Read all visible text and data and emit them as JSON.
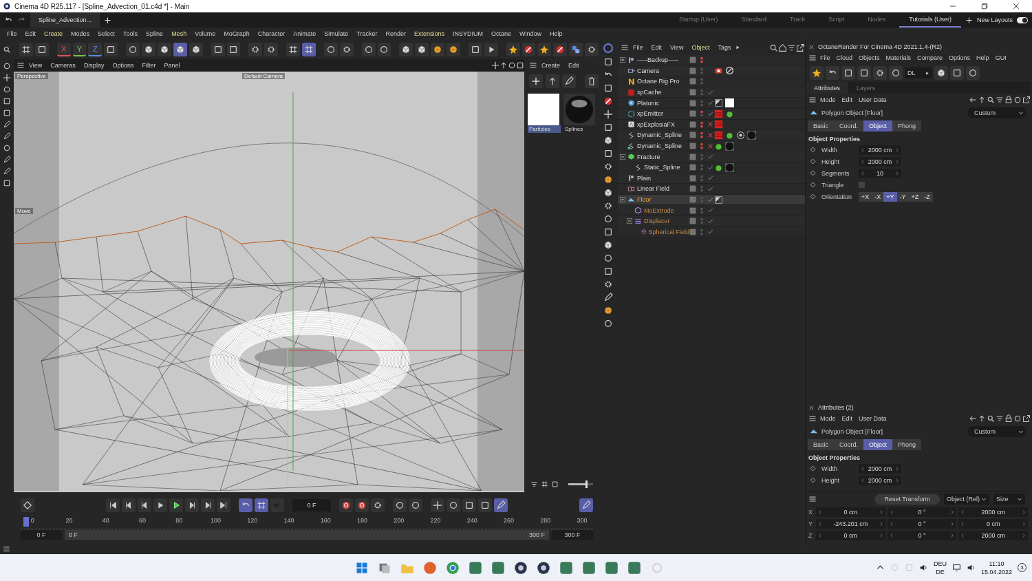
{
  "window": {
    "title": "Cinema 4D R25.117 - [Spline_Advection_01.c4d *] - Main"
  },
  "document_tab": {
    "label": "Spline_Advection..."
  },
  "layouts": [
    {
      "label": "Startup (User)",
      "selected": false
    },
    {
      "label": "Standard",
      "selected": false
    },
    {
      "label": "Track",
      "selected": false
    },
    {
      "label": "Script",
      "selected": false
    },
    {
      "label": "Nodes",
      "selected": false
    },
    {
      "label": "Tutorials (User)",
      "selected": true
    }
  ],
  "new_layouts": {
    "label": "New Layouts",
    "on": true
  },
  "menu": [
    {
      "label": "File",
      "highlight": false
    },
    {
      "label": "Edit",
      "highlight": false
    },
    {
      "label": "Create",
      "highlight": true
    },
    {
      "label": "Modes",
      "highlight": false
    },
    {
      "label": "Select",
      "highlight": false
    },
    {
      "label": "Tools",
      "highlight": false
    },
    {
      "label": "Spline",
      "highlight": false
    },
    {
      "label": "Mesh",
      "highlight": true
    },
    {
      "label": "Volume",
      "highlight": false
    },
    {
      "label": "MoGraph",
      "highlight": false
    },
    {
      "label": "Character",
      "highlight": false
    },
    {
      "label": "Animate",
      "highlight": false
    },
    {
      "label": "Simulate",
      "highlight": false
    },
    {
      "label": "Tracker",
      "highlight": false
    },
    {
      "label": "Render",
      "highlight": false
    },
    {
      "label": "Extensions",
      "highlight": true
    },
    {
      "label": "INSYDIUM",
      "highlight": false
    },
    {
      "label": "Octane",
      "highlight": false
    },
    {
      "label": "Window",
      "highlight": false
    },
    {
      "label": "Help",
      "highlight": false
    }
  ],
  "axis_locks": [
    {
      "label": "X",
      "color": "#e05555"
    },
    {
      "label": "Y",
      "color": "#7fbf4a"
    },
    {
      "label": "Z",
      "color": "#5a8ee0"
    }
  ],
  "viewport": {
    "menu": [
      "View",
      "Cameras",
      "Display",
      "Options",
      "Filter",
      "Panel"
    ],
    "camera_label": "Perspective",
    "camera_name": "Default Camera",
    "tool_label": "Move"
  },
  "content_browser": {
    "menu": [
      "Create",
      "Edit"
    ],
    "materials": [
      {
        "name": "Particles",
        "kind": "white",
        "selected": true
      },
      {
        "name": "Splines",
        "kind": "black",
        "selected": false
      }
    ],
    "zoom": {
      "level": 0.7
    }
  },
  "object_manager": {
    "menu": [
      {
        "label": "File",
        "highlight": false
      },
      {
        "label": "Edit",
        "highlight": false
      },
      {
        "label": "View",
        "highlight": false
      },
      {
        "label": "Object",
        "highlight": true
      },
      {
        "label": "Tags",
        "highlight": false
      }
    ],
    "objects": [
      {
        "name": "-----Backup-----",
        "kind": "null",
        "selected": false,
        "expanded": false,
        "editor_visible": false,
        "render_visible": false
      },
      {
        "name": "Camera",
        "kind": "camera",
        "selected": false,
        "editor_visible": true,
        "render_visible": true,
        "tags": [
          {
            "kind": "camera"
          },
          {
            "kind": "forbid"
          }
        ]
      },
      {
        "name": "Octane Rig Pro",
        "kind": "octane",
        "selected": false,
        "editor_visible": true,
        "render_visible": true
      },
      {
        "name": "xpCache",
        "kind": "xp",
        "selected": false,
        "editor_visible": true,
        "render_visible": true,
        "enabled": true
      },
      {
        "name": "Platonic",
        "kind": "platonic",
        "selected": false,
        "editor_visible": true,
        "render_visible": true,
        "enabled": true,
        "tags": [
          {
            "kind": "display"
          },
          {
            "kind": "white-material"
          }
        ]
      },
      {
        "name": "xpEmitter",
        "kind": "emitter",
        "selected": false,
        "editor_visible": false,
        "render_visible": true,
        "enabled": true,
        "tags": [
          {
            "kind": "xp"
          },
          {
            "kind": "green-dot"
          }
        ]
      },
      {
        "name": "xpExplosiaFX",
        "kind": "explosia",
        "selected": false,
        "editor_visible": false,
        "render_visible": false,
        "enabled": false,
        "tags": [
          {
            "kind": "xp"
          }
        ]
      },
      {
        "name": "Dynamic_Spline",
        "kind": "spline",
        "selected": false,
        "editor_visible": false,
        "render_visible": false,
        "enabled": false,
        "tags": [
          {
            "kind": "xp"
          },
          {
            "kind": "green-dot"
          },
          {
            "kind": "target"
          },
          {
            "kind": "black-material"
          }
        ]
      },
      {
        "name": "Dynamic_Spline",
        "kind": "spline-gen",
        "selected": false,
        "editor_visible": false,
        "render_visible": false,
        "enabled": false,
        "tags": [
          {
            "kind": "green-dot"
          },
          {
            "kind": "black-material"
          }
        ]
      },
      {
        "name": "Fracture",
        "kind": "fracture",
        "selected": false,
        "expanded": true,
        "editor_visible": true,
        "render_visible": true,
        "enabled": true,
        "children": [
          {
            "name": "Static_Spline",
            "kind": "spline",
            "selected": false,
            "editor_visible": true,
            "render_visible": true,
            "enabled": true,
            "tags": [
              {
                "kind": "green-dot"
              },
              {
                "kind": "black-material"
              }
            ]
          }
        ]
      },
      {
        "name": "Plain",
        "kind": "null",
        "selected": false,
        "editor_visible": true,
        "render_visible": true,
        "enabled": true
      },
      {
        "name": "Linear Field",
        "kind": "field",
        "selected": false,
        "editor_visible": true,
        "render_visible": true,
        "enabled": true
      },
      {
        "name": "Floor",
        "kind": "plane",
        "selected": true,
        "expanded": true,
        "editor_visible": true,
        "render_visible": true,
        "enabled": true,
        "tags": [
          {
            "kind": "display"
          }
        ],
        "children": [
          {
            "name": "MoExtrude",
            "kind": "moextrude",
            "selected": false,
            "editor_visible": true,
            "render_visible": true,
            "enabled": true
          },
          {
            "name": "Displacer",
            "kind": "displacer",
            "selected": false,
            "expanded": true,
            "editor_visible": true,
            "render_visible": true,
            "enabled": true,
            "children": [
              {
                "name": "Spherical Field",
                "kind": "sphere-field",
                "selected": false,
                "editor_visible": true,
                "render_visible": true,
                "enabled": true
              }
            ]
          }
        ]
      }
    ]
  },
  "octane": {
    "title": "OctaneRender For Cinema 4D 2021.1.4-(R2)",
    "menu": [
      "File",
      "Cloud",
      "Objects",
      "Materials",
      "Compare",
      "Options",
      "Help",
      "GUI"
    ],
    "dropdown": "DL"
  },
  "attributes": {
    "tabs": [
      {
        "label": "Attributes",
        "selected": true
      },
      {
        "label": "Layers",
        "selected": false
      }
    ],
    "menu": [
      "Mode",
      "Edit",
      "User Data"
    ],
    "object": "Polygon Object [Floor]",
    "preset": "Custom",
    "sections": [
      {
        "label": "Basic",
        "selected": false
      },
      {
        "label": "Coord.",
        "selected": false
      },
      {
        "label": "Object",
        "selected": true
      },
      {
        "label": "Phong",
        "selected": false
      }
    ],
    "heading": "Object Properties",
    "fields": [
      {
        "kind": "number",
        "label": "Width",
        "value": "2000 cm"
      },
      {
        "kind": "number",
        "label": "Height",
        "value": "2000 cm"
      },
      {
        "kind": "number",
        "label": "Segments",
        "value": "10"
      },
      {
        "kind": "checkbox",
        "label": "Triangle",
        "checked": false
      },
      {
        "kind": "buttons",
        "label": "Orientation",
        "options": [
          {
            "label": "+X",
            "selected": false
          },
          {
            "label": "-X",
            "selected": false
          },
          {
            "label": "+Y",
            "selected": true
          },
          {
            "label": "-Y",
            "selected": false
          },
          {
            "label": "+Z",
            "selected": false
          },
          {
            "label": "-Z",
            "selected": false
          }
        ]
      }
    ]
  },
  "attributes_2": {
    "title": "Attributes (2)",
    "menu": [
      "Mode",
      "Edit",
      "User Data"
    ],
    "object": "Polygon Object [Floor]",
    "preset": "Custom",
    "sections": [
      {
        "label": "Basic",
        "selected": false
      },
      {
        "label": "Coord.",
        "selected": false
      },
      {
        "label": "Object",
        "selected": true
      },
      {
        "label": "Phong",
        "selected": false
      }
    ],
    "heading": "Object Properties",
    "fields": [
      {
        "kind": "number",
        "label": "Width",
        "value": "2000 cm"
      },
      {
        "kind": "number",
        "label": "Height",
        "value": "2000 cm"
      }
    ]
  },
  "coordinates": {
    "reset": "Reset Transform",
    "mode": "Object (Rel)",
    "size_mode": "Size",
    "rows": [
      {
        "axis": "X",
        "values": [
          "0 cm",
          "0 °",
          "2000 cm"
        ]
      },
      {
        "axis": "Y",
        "values": [
          "-243.201 cm",
          "0 °",
          "0 cm"
        ]
      },
      {
        "axis": "Z",
        "values": [
          "0 cm",
          "0 °",
          "2000 cm"
        ]
      }
    ]
  },
  "timeline": {
    "frame": "0 F",
    "ruler_labels": [
      "0",
      "20",
      "40",
      "60",
      "80",
      "100",
      "120",
      "140",
      "160",
      "180",
      "200",
      "220",
      "240",
      "260",
      "280",
      "300"
    ],
    "playhead": {
      "level": 0
    },
    "range_start": "0 F",
    "range_min": "0 F",
    "range_max": "300 F",
    "range_end": "300 F"
  },
  "taskbar": {
    "language": "DEU",
    "layout": "DE",
    "time": "11:10",
    "date": "15.04.2022",
    "notifications": "3"
  }
}
